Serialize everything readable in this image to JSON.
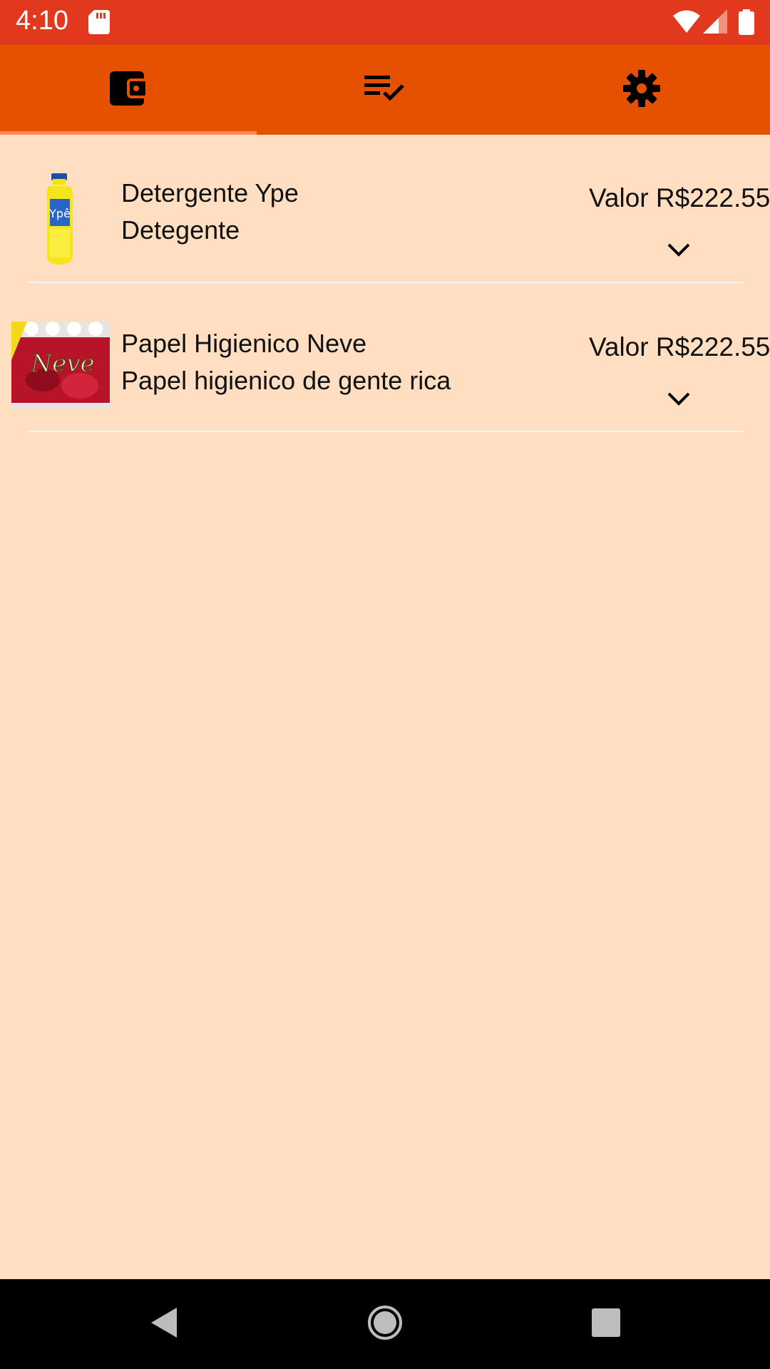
{
  "status_bar": {
    "time": "4:10",
    "icons": [
      "sd-card-icon",
      "wifi-icon",
      "cell-signal-icon",
      "battery-icon"
    ]
  },
  "tabs": [
    {
      "icon": "wallet-icon",
      "selected": true
    },
    {
      "icon": "checklist-icon",
      "selected": false
    },
    {
      "icon": "gear-icon",
      "selected": false
    }
  ],
  "items": [
    {
      "name": "Detergente Ype",
      "description": "Detegente",
      "price": "Valor R$222.55",
      "image": "detergent-bottle-image",
      "expand_icon": "chevron-down-icon"
    },
    {
      "name": "Papel Higienico Neve",
      "description": "Papel higienico de gente rica",
      "price": "Valor R$222.55",
      "image": "toilet-paper-pack-image",
      "image_brand_text": "Neve",
      "expand_icon": "chevron-down-icon"
    }
  ],
  "nav": [
    "back-icon",
    "home-icon",
    "recents-icon"
  ],
  "colors": {
    "status_bar": "#E2391E",
    "tab_bar": "#E55100",
    "tab_indicator": "#FF8A50",
    "background": "#FFDEC2"
  }
}
